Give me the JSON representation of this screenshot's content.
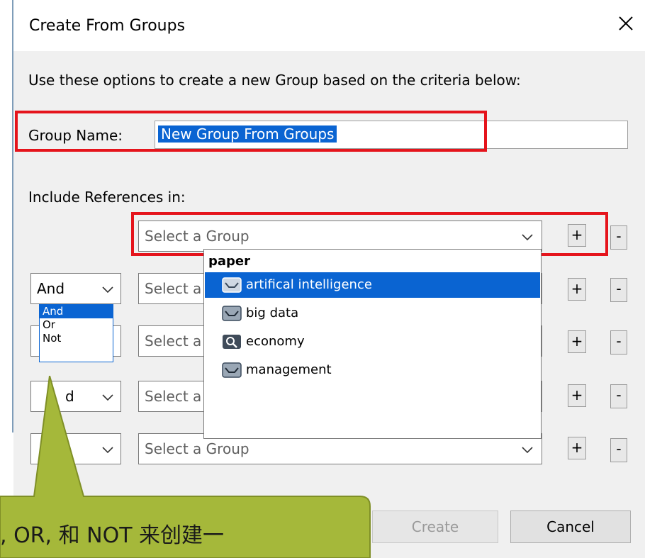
{
  "window": {
    "title": "Create From Groups"
  },
  "intro_text": "Use these options to create a new Group based on the criteria below:",
  "group_name": {
    "label": "Group Name:",
    "value": "New Group From Groups"
  },
  "include_label": "Include References in:",
  "select_placeholder": "Select a Group",
  "select_placeholder_truncated": "Select a",
  "rows": [
    {
      "operator": null
    },
    {
      "operator": "And"
    },
    {
      "operator": ""
    },
    {
      "operator": "d"
    },
    {
      "operator": ""
    }
  ],
  "operator_options": [
    {
      "label": "And",
      "selected": true
    },
    {
      "label": "Or",
      "selected": false
    },
    {
      "label": "Not",
      "selected": false
    }
  ],
  "group_dropdown": {
    "header": "paper",
    "items": [
      {
        "label": "artifical intelligence",
        "icon": "group-tray-icon",
        "selected": true
      },
      {
        "label": "big data",
        "icon": "group-tray-icon",
        "selected": false
      },
      {
        "label": "economy",
        "icon": "search-group-icon",
        "selected": false
      },
      {
        "label": "management",
        "icon": "group-tray-icon",
        "selected": false
      }
    ]
  },
  "plus_label": "+",
  "minus_label": "-",
  "buttons": {
    "create": "Create",
    "cancel": "Cancel"
  },
  "callout": {
    "text": ", OR, 和 NOT 来创建一",
    "color": "#a5b83a"
  },
  "colors": {
    "highlight": "#0a64d2",
    "annotation_red": "#e5141c"
  }
}
